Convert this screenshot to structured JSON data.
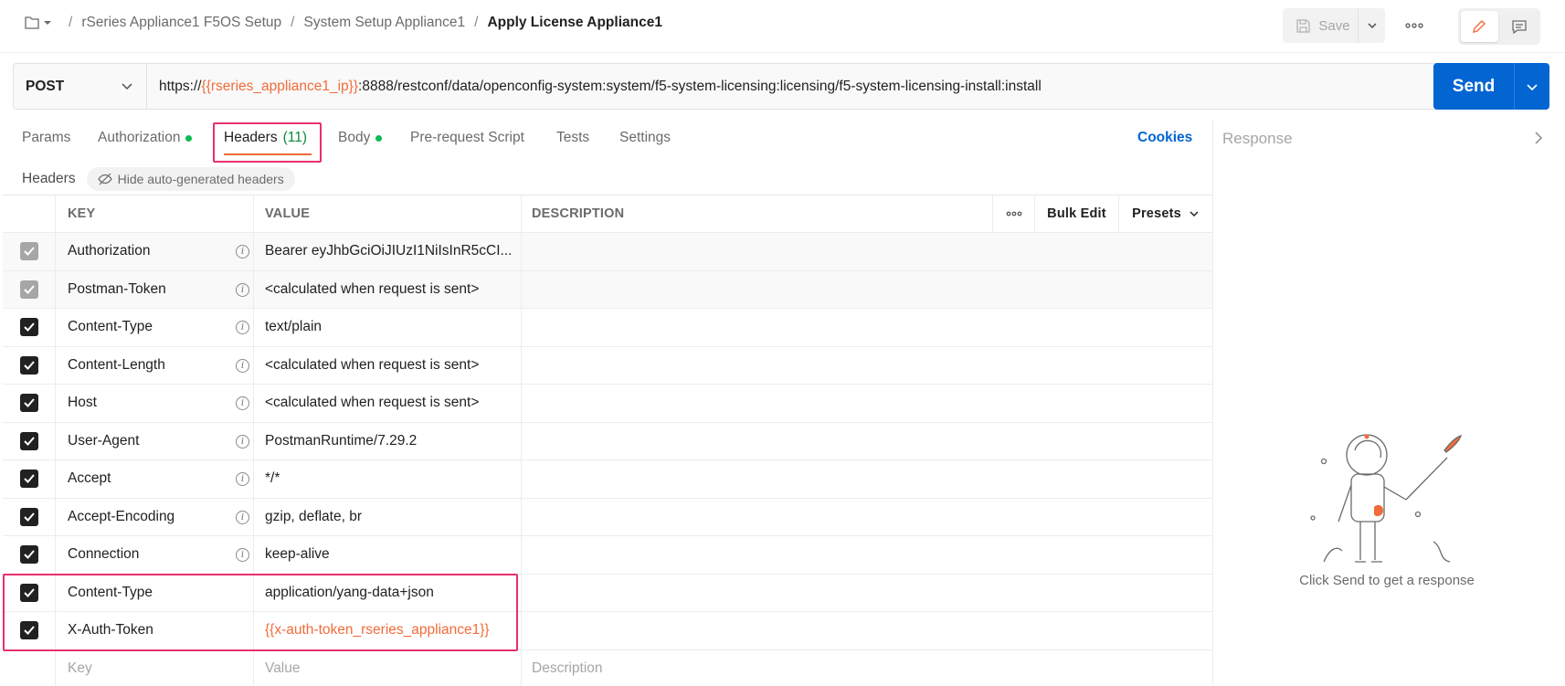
{
  "breadcrumb": {
    "items": [
      "rSeries Appliance1 F5OS Setup",
      "System Setup Appliance1"
    ],
    "current": "Apply License Appliance1",
    "separator": "/"
  },
  "toolbar": {
    "save_label": "Save"
  },
  "request": {
    "method": "POST",
    "url_prefix": "https://",
    "url_variable": "{{rseries_appliance1_ip}}",
    "url_suffix": ":8888/restconf/data/openconfig-system:system/f5-system-licensing:licensing/f5-system-licensing-install:install",
    "send_label": "Send"
  },
  "tabs": [
    {
      "label": "Params"
    },
    {
      "label": "Authorization"
    },
    {
      "label": "Headers",
      "count": "(11)"
    },
    {
      "label": "Body"
    },
    {
      "label": "Pre-request Script"
    },
    {
      "label": "Tests"
    },
    {
      "label": "Settings"
    }
  ],
  "cookies_label": "Cookies",
  "headers_section": {
    "title": "Headers",
    "hide_auto_label": "Hide auto-generated headers"
  },
  "table": {
    "columns": {
      "key": "KEY",
      "value": "VALUE",
      "description": "DESCRIPTION"
    },
    "bulk_edit": "Bulk Edit",
    "presets": "Presets",
    "rows": [
      {
        "key": "Authorization",
        "value": "Bearer eyJhbGciOiJIUzI1NiIsInR5cCI..."
      },
      {
        "key": "Postman-Token",
        "value": "<calculated when request is sent>"
      },
      {
        "key": "Content-Type",
        "value": "text/plain"
      },
      {
        "key": "Content-Length",
        "value": "<calculated when request is sent>"
      },
      {
        "key": "Host",
        "value": "<calculated when request is sent>"
      },
      {
        "key": "User-Agent",
        "value": "PostmanRuntime/7.29.2"
      },
      {
        "key": "Accept",
        "value": "*/*"
      },
      {
        "key": "Accept-Encoding",
        "value": "gzip, deflate, br"
      },
      {
        "key": "Connection",
        "value": "keep-alive"
      },
      {
        "key": "Content-Type",
        "value": "application/yang-data+json"
      },
      {
        "key": "X-Auth-Token",
        "value": "{{x-auth-token_rseries_appliance1}}"
      }
    ],
    "placeholder": {
      "key": "Key",
      "value": "Value",
      "description": "Description"
    }
  },
  "response": {
    "title": "Response",
    "empty_message": "Click Send to get a response"
  },
  "colors": {
    "accent": "#0265d2",
    "variable": "#f26b3a",
    "highlight": "#e8306e",
    "status_dot": "#0cbb52"
  }
}
